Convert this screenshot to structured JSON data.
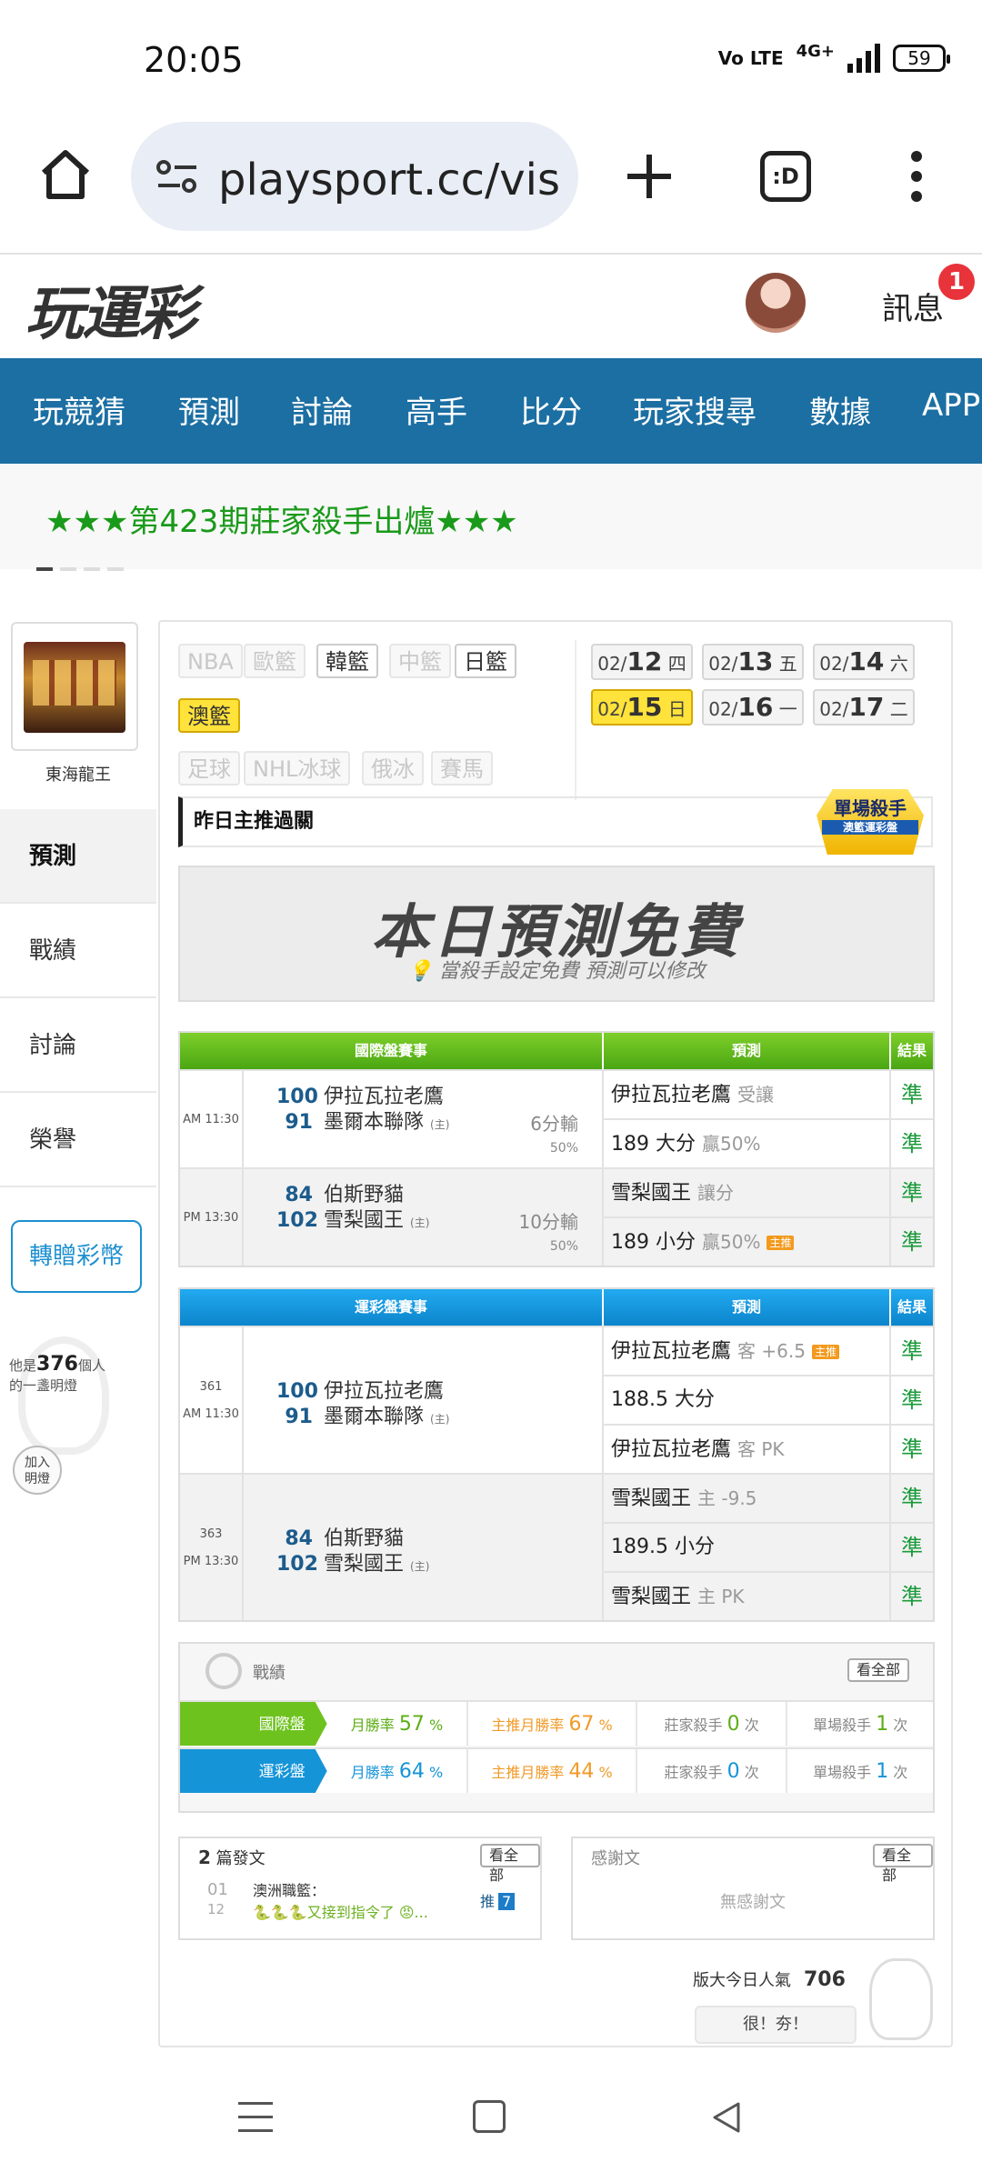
{
  "status_bar": {
    "time": "20:05",
    "volte": "Vo LTE",
    "network": "4G+",
    "battery": "59"
  },
  "browser": {
    "url": "playsport.cc/visit",
    "tabs_label": ":D"
  },
  "site": {
    "logo": "玩運彩",
    "messages_label": "訊息",
    "messages_count": "1"
  },
  "nav": {
    "items": [
      "玩競猜",
      "預測",
      "討論",
      "高手",
      "比分",
      "玩家搜尋",
      "數據",
      "APP"
    ]
  },
  "marquee": {
    "text": "★★★第423期莊家殺手出爐★★★"
  },
  "sidebar": {
    "user_name": "東海龍王",
    "menu": [
      "預測",
      "戰績",
      "討論",
      "榮譽"
    ],
    "transfer_label": "轉贈彩幣",
    "lamp_prefix": "他是",
    "lamp_count": "376",
    "lamp_suffix": "個人",
    "lamp_line2": "的一盞明燈",
    "join_line1": "加入",
    "join_line2": "明燈"
  },
  "sports": {
    "row1": [
      "NBA",
      "歐籃",
      "韓籃",
      "中籃",
      "日籃"
    ],
    "row2": [
      "澳籃"
    ],
    "row3": [
      "足球",
      "NHL冰球",
      "俄冰",
      "賽馬"
    ]
  },
  "dates": [
    {
      "date": "02/",
      "day": "12",
      "weekday": "四"
    },
    {
      "date": "02/",
      "day": "13",
      "weekday": "五"
    },
    {
      "date": "02/",
      "day": "14",
      "weekday": "六"
    },
    {
      "date": "02/",
      "day": "15",
      "weekday": "日"
    },
    {
      "date": "02/",
      "day": "16",
      "weekday": "一"
    },
    {
      "date": "02/",
      "day": "17",
      "weekday": "二"
    }
  ],
  "yesterday_bar": "昨日主推過關",
  "killer_badge": {
    "title": "單場殺手",
    "sub": "澳籃運彩盤"
  },
  "free_banner": {
    "title": "本日預測免費",
    "subtitle": "當殺手設定免費 預測可以修改"
  },
  "intl_table": {
    "headers": [
      "國際盤賽事",
      "預測",
      "結果"
    ],
    "games": [
      {
        "time": "AM 11:30",
        "away_score": "100",
        "away_team": "伊拉瓦拉老鷹",
        "home_score": "91",
        "home_team": "墨爾本聯隊",
        "home_mark": "(主)",
        "note_main": "6分輸",
        "note_sub": "50%",
        "preds": [
          {
            "main": "伊拉瓦拉老鷹",
            "sub": "受讓",
            "tag": ""
          },
          {
            "main": "189 大分",
            "sub": "贏50%",
            "tag": ""
          }
        ],
        "results": [
          "準",
          "準"
        ]
      },
      {
        "time": "PM 13:30",
        "away_score": "84",
        "away_team": "伯斯野貓",
        "home_score": "102",
        "home_team": "雪梨國王",
        "home_mark": "(主)",
        "note_main": "10分輸",
        "note_sub": "50%",
        "preds": [
          {
            "main": "雪梨國王",
            "sub": "讓分",
            "tag": ""
          },
          {
            "main": "189 小分",
            "sub": "贏50%",
            "tag": "主推"
          }
        ],
        "results": [
          "準",
          "準"
        ]
      }
    ]
  },
  "lottery_table": {
    "headers": [
      "運彩盤賽事",
      "預測",
      "結果"
    ],
    "games": [
      {
        "num": "361",
        "time": "AM 11:30",
        "away_score": "100",
        "away_team": "伊拉瓦拉老鷹",
        "home_score": "91",
        "home_team": "墨爾本聯隊",
        "home_mark": "(主)",
        "preds": [
          {
            "main": "伊拉瓦拉老鷹",
            "sub": "客 +6.5",
            "tag": "主推"
          },
          {
            "main": "188.5 大分",
            "sub": "",
            "tag": ""
          },
          {
            "main": "伊拉瓦拉老鷹",
            "sub": "客 PK",
            "tag": ""
          }
        ],
        "results": [
          "準",
          "準",
          "準"
        ]
      },
      {
        "num": "363",
        "time": "PM 13:30",
        "away_score": "84",
        "away_team": "伯斯野貓",
        "home_score": "102",
        "home_team": "雪梨國王",
        "home_mark": "(主)",
        "preds": [
          {
            "main": "雪梨國王",
            "sub": "主 -9.5",
            "tag": ""
          },
          {
            "main": "189.5 小分",
            "sub": "",
            "tag": ""
          },
          {
            "main": "雪梨國王",
            "sub": "主 PK",
            "tag": ""
          }
        ],
        "results": [
          "準",
          "準",
          "準"
        ]
      }
    ]
  },
  "record": {
    "title": "戰績",
    "see_all": "看全部",
    "rows": [
      {
        "label": "國際盤",
        "month_label": "月勝率",
        "month": "57",
        "main_label": "主推月勝率",
        "main": "67",
        "pct": "%",
        "banker_label": "莊家殺手",
        "banker": "0",
        "single_label": "單場殺手",
        "single": "1",
        "times": "次"
      },
      {
        "label": "運彩盤",
        "month_label": "月勝率",
        "month": "64",
        "main_label": "主推月勝率",
        "main": "44",
        "pct": "%",
        "banker_label": "莊家殺手",
        "banker": "0",
        "single_label": "單場殺手",
        "single": "1",
        "times": "次"
      }
    ]
  },
  "posts": {
    "count": "2",
    "title": "篇發文",
    "see_all": "看全部",
    "item": {
      "month": "01",
      "day": "12",
      "title": "澳洲職籃：",
      "body": "🐍🐍🐍又接到指令了 😡...",
      "push_label": "推",
      "push_count": "7"
    }
  },
  "thanks": {
    "title": "感謝文",
    "see_all": "看全部",
    "empty": "無感謝文"
  },
  "popularity": {
    "label": "版大今日人氣",
    "value": "706"
  },
  "great_button": "很！夯！"
}
